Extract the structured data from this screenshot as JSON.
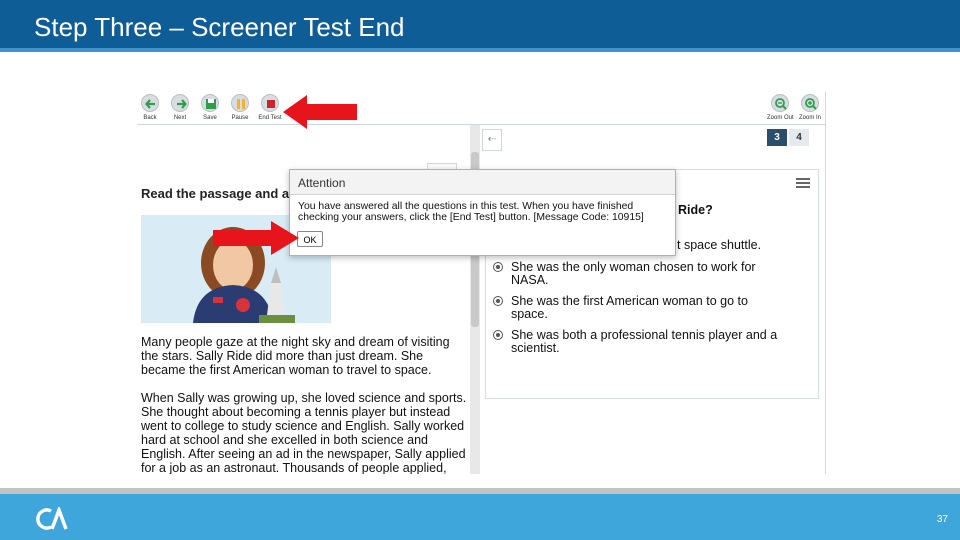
{
  "slide": {
    "title": "Step Three – Screener Test End",
    "page_number": "37"
  },
  "toolbar": {
    "buttons": [
      {
        "label": "Back",
        "icon": "arrow-left-icon"
      },
      {
        "label": "Next",
        "icon": "arrow-right-icon"
      },
      {
        "label": "Save",
        "icon": "floppy-disk-icon"
      },
      {
        "label": "Pause",
        "icon": "pause-icon"
      },
      {
        "label": "End Test",
        "icon": "stop-icon"
      }
    ],
    "zoom_out_label": "Zoom Out",
    "zoom_in_label": "Zoom In"
  },
  "passage": {
    "heading": "Read the passage and answer the questions.",
    "paragraph1": "Many people gaze at the night sky and dream of visiting the stars. Sally Ride did more than just dream. She became the first American woman to travel to space.",
    "paragraph2": "When Sally was growing up, she loved science and sports. She thought about becoming a tennis player but instead went to college to study science and English. Sally worked hard at school and she excelled in both science and English. After seeing an ad in the newspaper, Sally applied for a job as an astronaut. Thousands of people applied, but only a few were"
  },
  "questions": {
    "tabs": [
      "3",
      "4"
    ],
    "active_tab": "3",
    "visible_stem_fragment": "Ride?",
    "options": [
      {
        "fragment": "t space shuttle."
      },
      {
        "line1": "She was the only woman chosen to work for",
        "line2": "NASA."
      },
      {
        "line1": "She was the first American woman to go to",
        "line2": "space."
      },
      {
        "line1": "She was both a professional tennis player and a",
        "line2": "scientist."
      }
    ]
  },
  "dialog": {
    "title": "Attention",
    "message_line1": "You have answered all the questions in this test. When you have finished",
    "message_line2": "checking your answers, click the [End Test] button. [Message Code: 10915]",
    "ok_label": "OK"
  },
  "colors": {
    "title_bar": "#0e5d96",
    "footer": "#3ea6db",
    "arrow": "#e8141b",
    "end_test": "#c9252b",
    "tab_active": "#2b4f6b"
  }
}
